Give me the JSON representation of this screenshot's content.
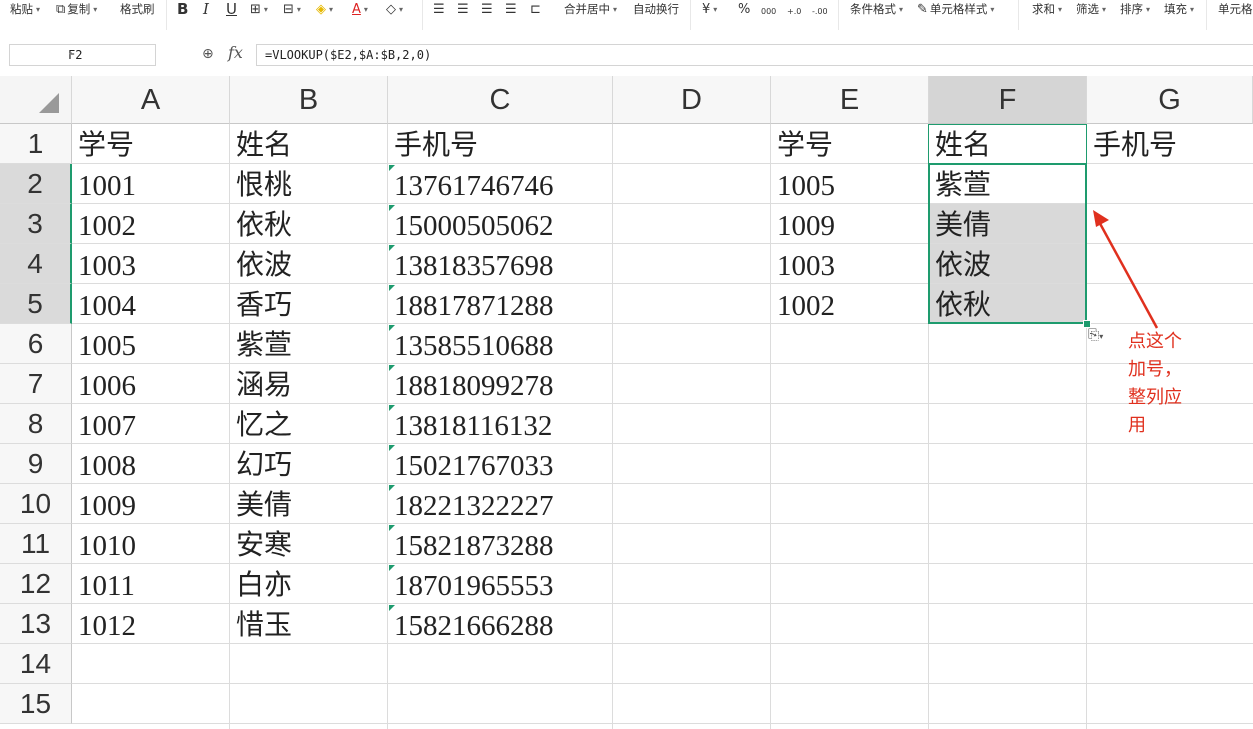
{
  "ribbon": {
    "paste": "粘贴",
    "copy": "复制",
    "format_painter": "格式刷",
    "bold": "B",
    "italic": "I",
    "underline": "U",
    "merge_center": "合并居中",
    "wrap_text": "自动换行",
    "currency": "¥",
    "percent": "%",
    "thousands": "000",
    "inc_decimal": "+.0",
    "dec_decimal": "-.00",
    "cond_format": "条件格式",
    "cell_style": "单元格样式",
    "sum": "求和",
    "filter": "筛选",
    "sort": "排序",
    "fill": "填充",
    "cell": "单元格"
  },
  "formula_bar": {
    "name_box": "F2",
    "fx": "fx",
    "formula": "=VLOOKUP($E2,$A:$B,2,0)"
  },
  "columns": [
    "A",
    "B",
    "C",
    "D",
    "E",
    "F",
    "G"
  ],
  "rows": [
    "1",
    "2",
    "3",
    "4",
    "5",
    "6",
    "7",
    "8",
    "9",
    "10",
    "11",
    "12",
    "13",
    "14",
    "15"
  ],
  "sheet": {
    "A": [
      "学号",
      "1001",
      "1002",
      "1003",
      "1004",
      "1005",
      "1006",
      "1007",
      "1008",
      "1009",
      "1010",
      "1011",
      "1012"
    ],
    "B": [
      "姓名",
      "恨桃",
      "依秋",
      "依波",
      "香巧",
      "紫萱",
      "涵易",
      "忆之",
      "幻巧",
      "美倩",
      "安寒",
      "白亦",
      "惜玉"
    ],
    "C": [
      "手机号",
      "13761746746",
      "15000505062",
      "13818357698",
      "18817871288",
      "13585510688",
      "18818099278",
      "13818116132",
      "15021767033",
      "18221322227",
      "15821873288",
      "18701965553",
      "15821666288"
    ],
    "E": [
      "学号",
      "1005",
      "1009",
      "1003",
      "1002"
    ],
    "F": [
      "姓名",
      "紫萱",
      "美倩",
      "依波",
      "依秋"
    ],
    "G": [
      "手机号"
    ]
  },
  "annotation": {
    "lines": [
      "点这个",
      "加号，",
      "整列应",
      "用"
    ],
    "color": "#e0301e"
  },
  "colors": {
    "selection_border": "#1e9b6e",
    "selection_fill": "#d9d9d9",
    "header_bg": "#f7f7f7"
  }
}
